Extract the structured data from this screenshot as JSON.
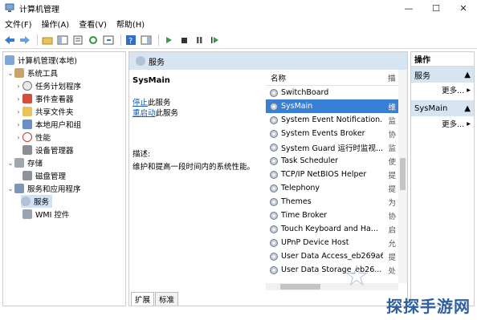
{
  "window": {
    "title": "计算机管理",
    "minimize": "—",
    "maximize": "☐",
    "close": "✕"
  },
  "menu": [
    "文件(F)",
    "操作(A)",
    "查看(V)",
    "帮助(H)"
  ],
  "tree": {
    "root": "计算机管理(本地)",
    "system_tools": "系统工具",
    "task_scheduler": "任务计划程序",
    "event_viewer": "事件查看器",
    "shared_folders": "共享文件夹",
    "local_users": "本地用户和组",
    "performance": "性能",
    "device_manager": "设备管理器",
    "storage": "存储",
    "disk_management": "磁盘管理",
    "services_apps": "服务和应用程序",
    "services": "服务",
    "wmi": "WMI 控件"
  },
  "services_panel": {
    "header": "服务",
    "selected_name": "SysMain",
    "stop_link": "停止",
    "stop_rest": "此服务",
    "restart_link": "重启动",
    "restart_rest": "此服务",
    "desc_label": "描述:",
    "desc_text": "维护和提高一段时间内的系统性能。",
    "col_name": "名称",
    "col_desc": "描",
    "rows": [
      {
        "name": "SwitchBoard",
        "desc": ""
      },
      {
        "name": "SysMain",
        "desc": "维"
      },
      {
        "name": "System Event Notification...",
        "desc": "监"
      },
      {
        "name": "System Events Broker",
        "desc": "协"
      },
      {
        "name": "System Guard 运行时监视...",
        "desc": "监"
      },
      {
        "name": "Task Scheduler",
        "desc": "使"
      },
      {
        "name": "TCP/IP NetBIOS Helper",
        "desc": "提"
      },
      {
        "name": "Telephony",
        "desc": "提"
      },
      {
        "name": "Themes",
        "desc": "为"
      },
      {
        "name": "Time Broker",
        "desc": "协"
      },
      {
        "name": "Touch Keyboard and Ha...",
        "desc": "启"
      },
      {
        "name": "UPnP Device Host",
        "desc": "允"
      },
      {
        "name": "User Data Access_eb269a6",
        "desc": "提"
      },
      {
        "name": "User Data Storage_eb26...",
        "desc": "处"
      }
    ],
    "tab_extended": "扩展",
    "tab_standard": "标准"
  },
  "actions": {
    "title": "操作",
    "section1": "服务",
    "more1": "更多...",
    "section2": "SysMain",
    "more2": "更多..."
  },
  "watermark": "探探手游网",
  "colors": {
    "selection": "#3a7fd6",
    "header_bg": "#d7e4f2",
    "link": "#1a5fb4"
  }
}
